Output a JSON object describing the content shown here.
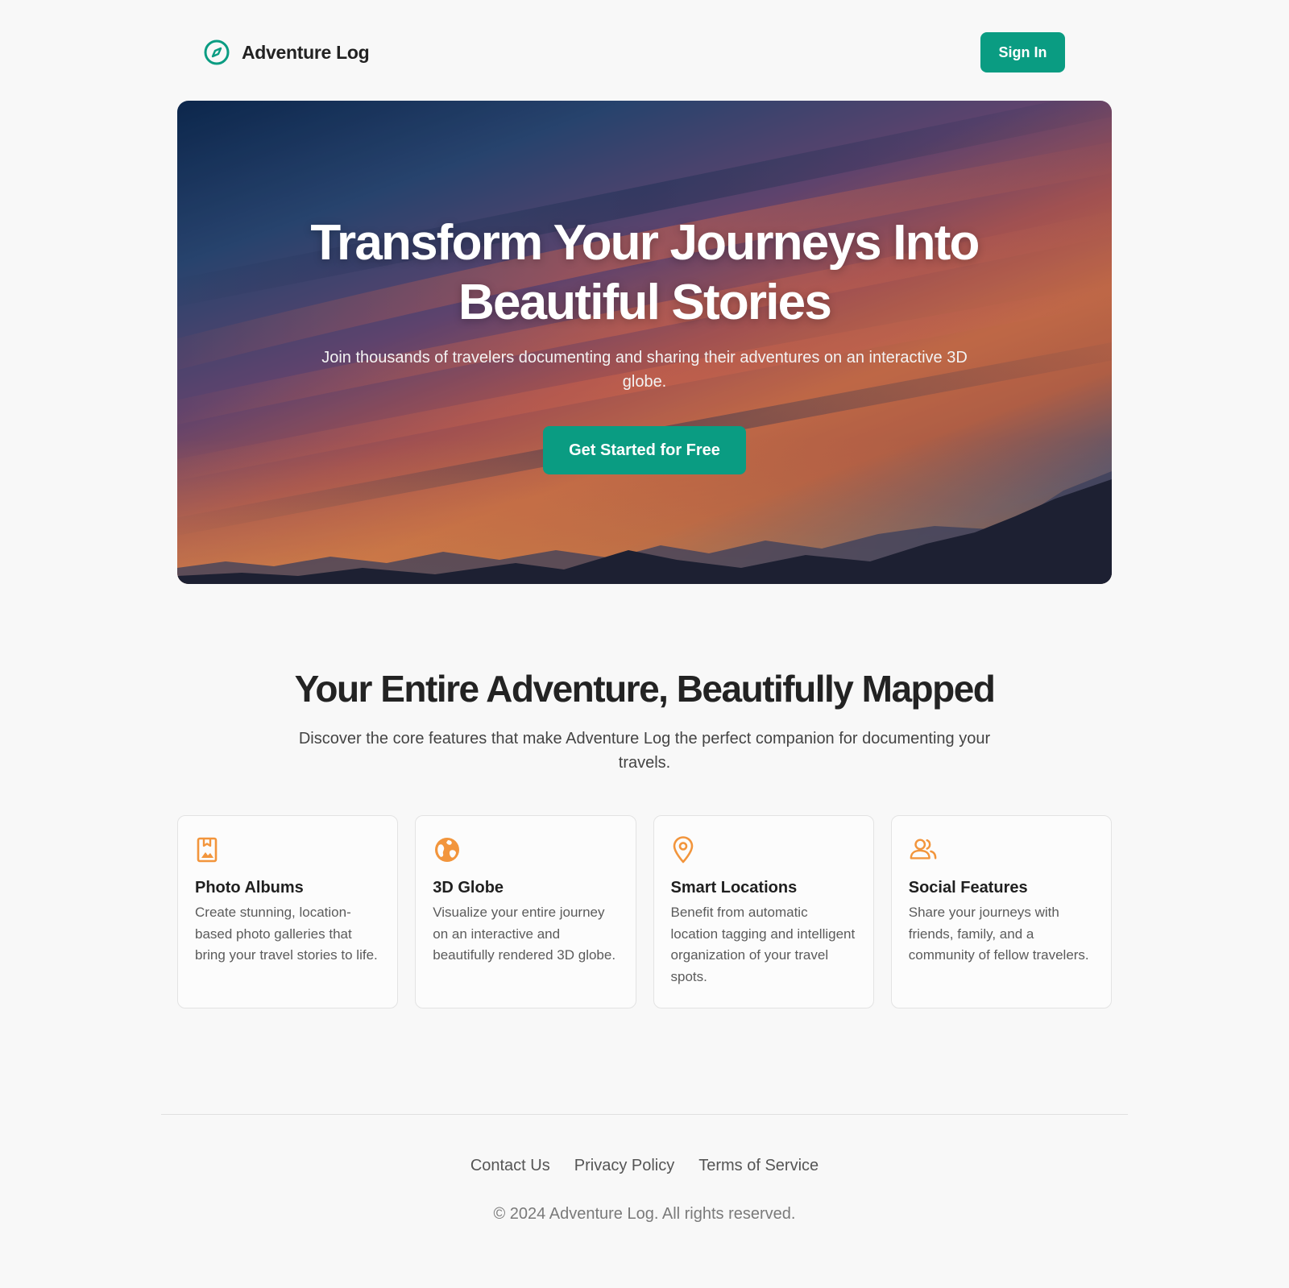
{
  "header": {
    "brand_name": "Adventure Log",
    "brand_icon": "compass-icon",
    "signin_label": "Sign In"
  },
  "hero": {
    "title": "Transform Your Journeys Into Beautiful Stories",
    "subtitle": "Join thousands of travelers documenting and sharing their adventures on an interactive 3D globe.",
    "cta_label": "Get Started for Free"
  },
  "features": {
    "title": "Your Entire Adventure, Beautifully Mapped",
    "subtitle": "Discover the core features that make Adventure Log the perfect companion for documenting your travels.",
    "items": [
      {
        "icon": "photo-album-icon",
        "title": "Photo Albums",
        "description": "Create stunning, location-based photo galleries that bring your travel stories to life."
      },
      {
        "icon": "globe-icon",
        "title": "3D Globe",
        "description": "Visualize your entire journey on an interactive and beautifully rendered 3D globe."
      },
      {
        "icon": "map-pin-icon",
        "title": "Smart Locations",
        "description": "Benefit from automatic location tagging and intelligent organization of your travel spots."
      },
      {
        "icon": "users-icon",
        "title": "Social Features",
        "description": "Share your journeys with friends, family, and a community of fellow travelers."
      }
    ]
  },
  "footer": {
    "links": [
      "Contact Us",
      "Privacy Policy",
      "Terms of Service"
    ],
    "copyright": "© 2024 Adventure Log. All rights reserved."
  },
  "colors": {
    "accent": "#0a9c82",
    "feature_icon": "#f2953c",
    "background": "#f8f8f8"
  }
}
